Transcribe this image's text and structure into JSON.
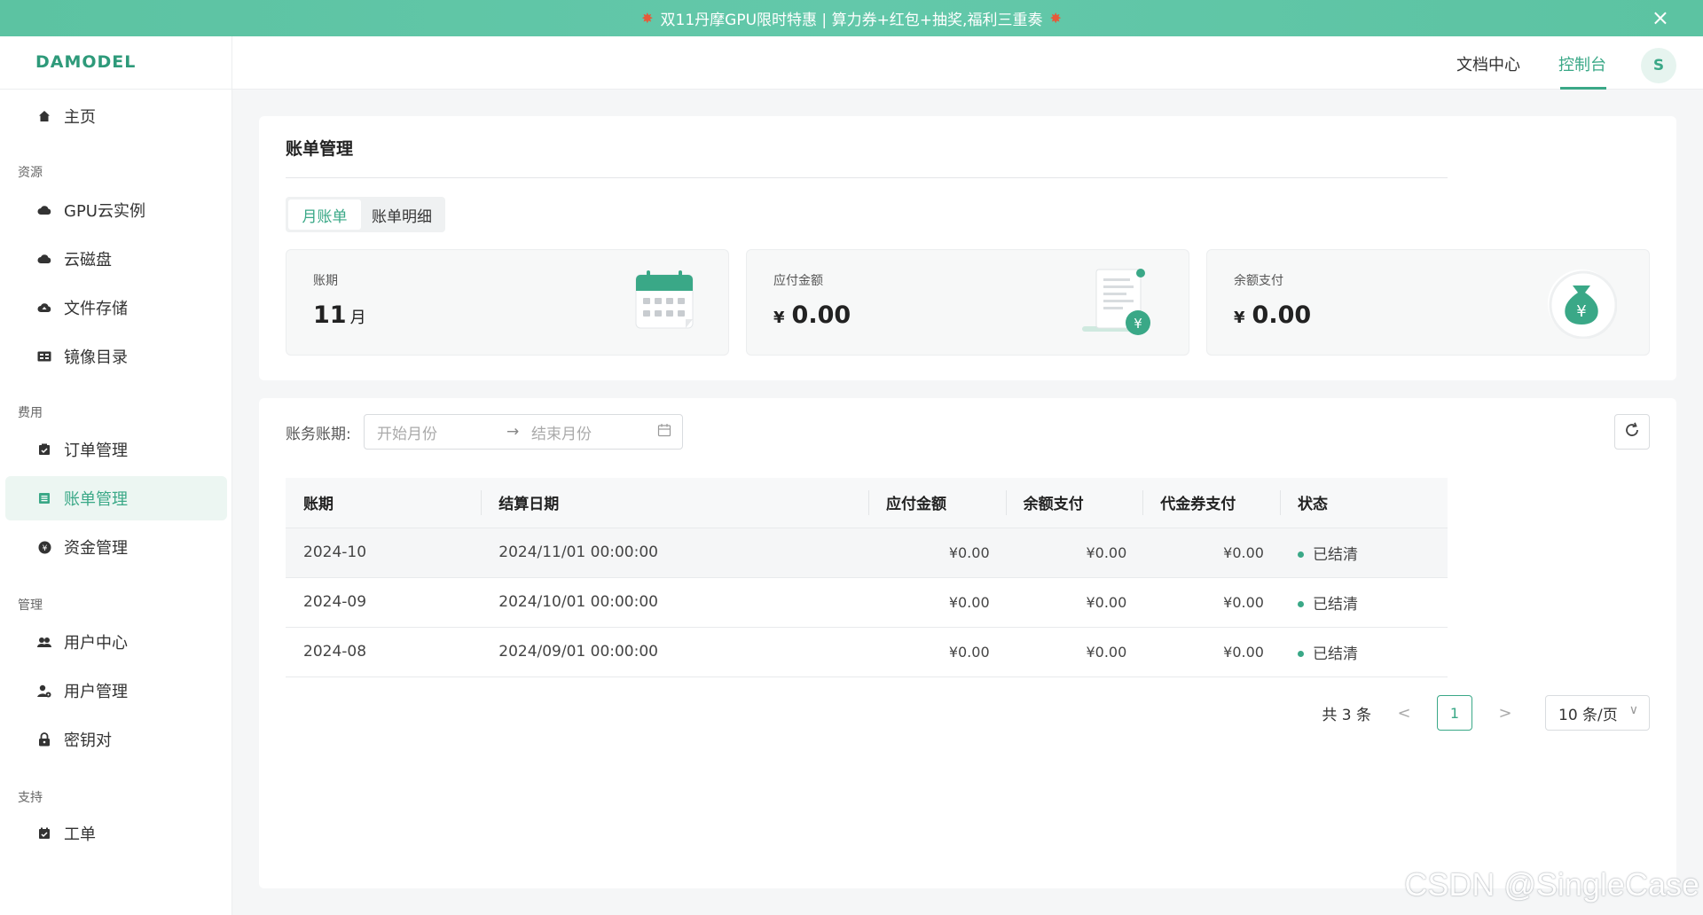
{
  "banner": {
    "text": "双11丹摩GPU限时特惠 | 算力券+红包+抽奖,福利三重奏",
    "close": "×"
  },
  "logo": "DAMODEL",
  "header": {
    "docs": "文档中心",
    "console": "控制台",
    "avatar": "S"
  },
  "sidebar": {
    "home": "主页",
    "sec_resources": "资源",
    "gpu": "GPU云实例",
    "disk": "云磁盘",
    "storage": "文件存储",
    "images": "镜像目录",
    "sec_billing": "费用",
    "orders": "订单管理",
    "bills": "账单管理",
    "funds": "资金管理",
    "sec_manage": "管理",
    "user_center": "用户中心",
    "user_manage": "用户管理",
    "keys": "密钥对",
    "sec_support": "支持",
    "tickets": "工单"
  },
  "overview": {
    "title": "账单管理",
    "tabs": {
      "monthly": "月账单",
      "detail": "账单明细"
    },
    "stats": {
      "period_label": "账期",
      "period_value": "11",
      "period_unit": "月",
      "payable_label": "应付金额",
      "payable_value": "0.00",
      "balance_label": "余额支付",
      "balance_value": "0.00",
      "currency": "¥"
    }
  },
  "filter": {
    "label": "账务账期:",
    "start_placeholder": "开始月份",
    "arrow": "→",
    "end_placeholder": "结束月份"
  },
  "table": {
    "headers": [
      "账期",
      "结算日期",
      "应付金额",
      "余额支付",
      "代金券支付",
      "状态"
    ],
    "rows": [
      {
        "period": "2024-10",
        "date": "2024/11/01 00:00:00",
        "payable": "¥0.00",
        "balance": "¥0.00",
        "voucher": "¥0.00",
        "status": "已结清"
      },
      {
        "period": "2024-09",
        "date": "2024/10/01 00:00:00",
        "payable": "¥0.00",
        "balance": "¥0.00",
        "voucher": "¥0.00",
        "status": "已结清"
      },
      {
        "period": "2024-08",
        "date": "2024/09/01 00:00:00",
        "payable": "¥0.00",
        "balance": "¥0.00",
        "voucher": "¥0.00",
        "status": "已结清"
      }
    ]
  },
  "pagination": {
    "total": "共 3 条",
    "prev": "<",
    "page": "1",
    "next": ">",
    "page_size": "10 条/页"
  },
  "watermark": "CSDN @SingleCase",
  "colors": {
    "accent": "#3aa887",
    "banner": "#5cc3a2"
  }
}
